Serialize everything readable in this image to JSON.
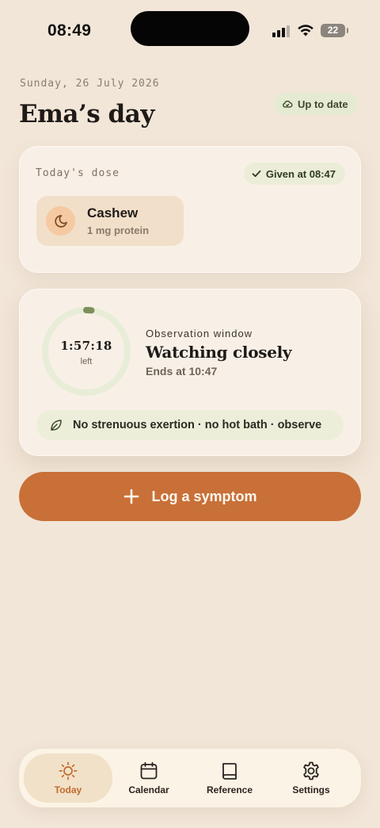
{
  "status_bar": {
    "time": "08:49",
    "battery": "22"
  },
  "header": {
    "date": "Sunday, 26 July 2026",
    "title": "Ema’s day",
    "sync_status": "Up to date"
  },
  "dose_card": {
    "label": "Today's dose",
    "given_badge": "Given at 08:47",
    "food_name": "Cashew",
    "food_amount": "1 mg protein",
    "food_icon": "moon-icon"
  },
  "observation_card": {
    "timer": "1:57:18",
    "timer_sub": "left",
    "progress_remaining_fraction": 0.98,
    "eyebrow": "Observation window",
    "title": "Watching closely",
    "ends": "Ends at 10:47",
    "advice": "No strenuous exertion · no hot bath · observe"
  },
  "actions": {
    "log_symptom": "Log a symptom"
  },
  "tab_bar": {
    "items": [
      {
        "label": "Today",
        "icon": "sun-icon",
        "active": true
      },
      {
        "label": "Calendar",
        "icon": "calendar-icon",
        "active": false
      },
      {
        "label": "Reference",
        "icon": "book-icon",
        "active": false
      },
      {
        "label": "Settings",
        "icon": "gear-icon",
        "active": false
      }
    ]
  },
  "colors": {
    "background": "#f2e6d8",
    "accent": "#c87038",
    "ring": "#7c8f5c",
    "badge_green": "#ebedd8"
  }
}
